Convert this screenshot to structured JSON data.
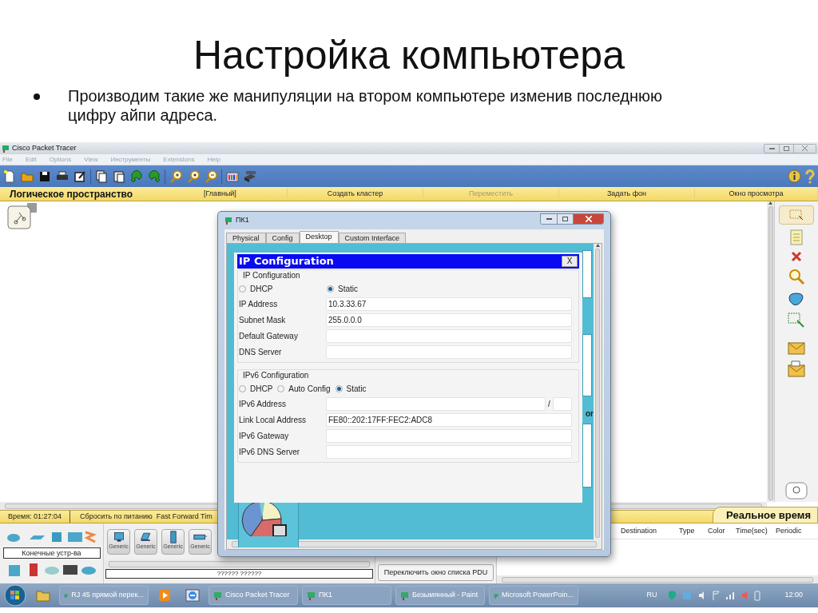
{
  "slide": {
    "title": "Настройка компьютера",
    "bullets": [
      "Производим такие же манипуляции на втором компьютере изменив последнюю цифру айпи адреса."
    ]
  },
  "window": {
    "title": "Cisco Packet Tracer"
  },
  "menu": [
    "File",
    "Edit",
    "Options",
    "View",
    "Инструменты",
    "Extensions",
    "Help"
  ],
  "workspace_bar": {
    "title": "Логическое пространство",
    "items": [
      {
        "label": "[Главный]",
        "disabled": false
      },
      {
        "label": "Создать кластер",
        "disabled": false
      },
      {
        "label": "Переместить",
        "disabled": true
      },
      {
        "label": "Задать фон",
        "disabled": false
      },
      {
        "label": "Окно просмотра",
        "disabled": false
      }
    ]
  },
  "dialog": {
    "title": "ПК1",
    "tabs": [
      {
        "label": "Physical",
        "selected": false
      },
      {
        "label": "Config",
        "selected": false
      },
      {
        "label": "Desktop",
        "selected": true
      },
      {
        "label": "Custom Interface",
        "selected": false
      }
    ],
    "background_fragment": "or",
    "ip_config": {
      "title": "IP Configuration",
      "close": "X",
      "ipv4": {
        "title": "IP Configuration",
        "modes": [
          {
            "label": "DHCP",
            "selected": false
          },
          {
            "label": "Static",
            "selected": true
          }
        ],
        "fields": [
          {
            "label": "IP Address",
            "value": "10.3.33.67"
          },
          {
            "label": "Subnet Mask",
            "value": "255.0.0.0"
          },
          {
            "label": "Default Gateway"
          },
          {
            "label": "DNS Server"
          }
        ]
      },
      "ipv6": {
        "title": "IPv6 Configuration",
        "modes": [
          {
            "label": "DHCP",
            "selected": false
          },
          {
            "label": "Auto Config",
            "selected": false
          },
          {
            "label": "Static",
            "selected": true
          }
        ],
        "fields": [
          {
            "label": "IPv6 Address",
            "separator": "/"
          },
          {
            "label": "Link Local Address",
            "value": "FE80::202:17FF:FEC2:ADC8"
          },
          {
            "label": "IPv6 Gateway"
          },
          {
            "label": "IPv6 DNS Server"
          }
        ]
      }
    }
  },
  "time_bar": {
    "time": "Время: 01:27:04",
    "buttons": [
      "Сбросить по питанию",
      "Fast Forward Tim"
    ],
    "mode": "Реальное время"
  },
  "devices": {
    "category": "Конечные устр-ва",
    "items": [
      "Generic",
      "Generic",
      "Generic",
      "Generic"
    ],
    "status": "?????? ??????"
  },
  "pdu": {
    "button": "Переключить окно списка PDU",
    "columns": [
      "Destination",
      "Type",
      "Color",
      "Time(sec)",
      "Periodic"
    ]
  },
  "taskbar": {
    "items": [
      {
        "kind": "pinned"
      },
      {
        "kind": "window",
        "label": "RJ 45 прямой перек..."
      },
      {
        "kind": "pinned"
      },
      {
        "kind": "pinned"
      },
      {
        "kind": "window",
        "label": "Cisco Packet Tracer"
      },
      {
        "kind": "window",
        "label": "ПК1"
      },
      {
        "kind": "window",
        "label": "Безымянный - Paint"
      },
      {
        "kind": "window",
        "label": "Microsoft PowerPoin..."
      }
    ],
    "language": "RU",
    "clock": "12:00"
  }
}
